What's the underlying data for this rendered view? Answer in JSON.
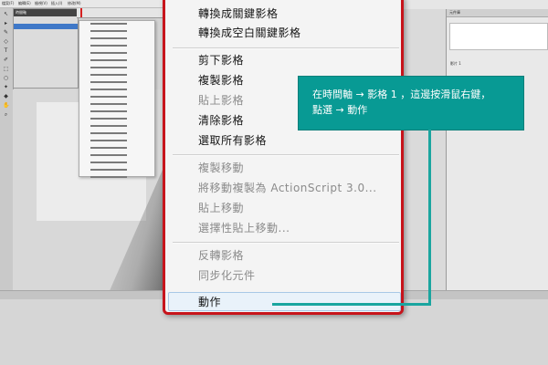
{
  "background": {
    "menu_labels": [
      "檔案(F)",
      "編輯(E)",
      "檢視(V)",
      "插入(I)",
      "修改(M)"
    ],
    "timeline_panel_title": "時間軸",
    "right_panel_title": "元件庫",
    "right_panel_item": "影片 1",
    "tools": [
      "↖",
      "▸",
      "✎",
      "◇",
      "T",
      "✐",
      "⬚",
      "○",
      "✦",
      "◆",
      "✋",
      "⌕"
    ]
  },
  "context_menu": {
    "items": [
      {
        "label": "轉換成關鍵影格",
        "enabled": true
      },
      {
        "label": "轉換成空白關鍵影格",
        "enabled": true
      },
      {
        "label": "剪下影格",
        "enabled": true
      },
      {
        "label": "複製影格",
        "enabled": true
      },
      {
        "label": "貼上影格",
        "enabled": false
      },
      {
        "label": "清除影格",
        "enabled": true
      },
      {
        "label": "選取所有影格",
        "enabled": true
      },
      {
        "label": "複製移動",
        "enabled": false
      },
      {
        "label": "將移動複製為 ActionScript 3.0...",
        "enabled": false
      },
      {
        "label": "貼上移動",
        "enabled": false
      },
      {
        "label": "選擇性貼上移動...",
        "enabled": false
      },
      {
        "label": "反轉影格",
        "enabled": false
      },
      {
        "label": "同步化元件",
        "enabled": false
      },
      {
        "label": "動作",
        "enabled": true,
        "highlighted": true
      }
    ]
  },
  "callout": {
    "line1": "在時間軸 → 影格 1 ，這邊按滑鼠右鍵，",
    "line2": "點選 → 動作",
    "color": "#089a94"
  },
  "colors": {
    "menu_border": "#c7141b",
    "highlight_bg": "#e9f2fa"
  }
}
